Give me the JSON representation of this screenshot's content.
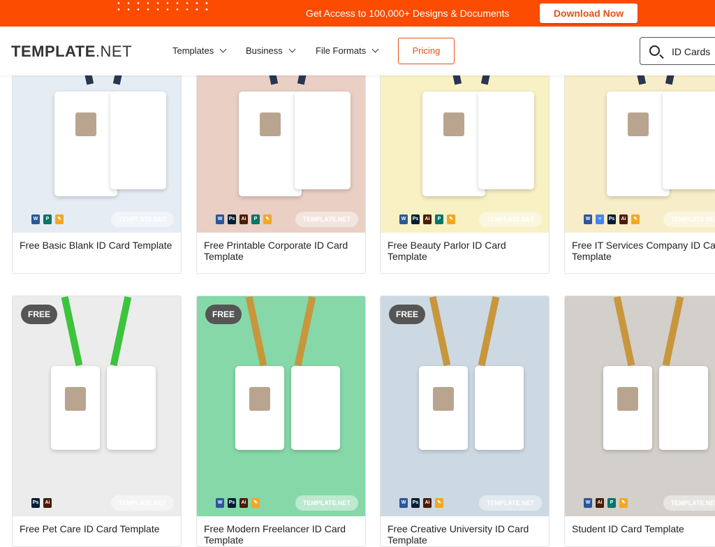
{
  "promo": {
    "text": "Get Access to 100,000+ Designs & Documents",
    "button": "Download Now",
    "color": "#fc4c02"
  },
  "header": {
    "logo_bold": "TEMPLATE",
    "logo_light": ".NET",
    "nav": [
      "Templates",
      "Business",
      "File Formats"
    ],
    "pricing": "Pricing",
    "search_value": "ID Cards"
  },
  "watermark": "TEMPLATE.NET",
  "badge_free": "FREE",
  "cards": [
    {
      "title": "Free Basic Blank ID Card Template",
      "formats": [
        "word",
        "publisher",
        "pages"
      ],
      "bg": "#e6ecf4",
      "free": false
    },
    {
      "title": "Free Printable Corporate ID Card Template",
      "formats": [
        "word",
        "photoshop",
        "illustrator",
        "publisher",
        "pages"
      ],
      "bg": "#e9cfc4",
      "free": false
    },
    {
      "title": "Free Beauty Parlor ID Card Template",
      "formats": [
        "word",
        "photoshop",
        "illustrator",
        "publisher",
        "pages"
      ],
      "bg": "#f8f1c4",
      "free": false
    },
    {
      "title": "Free IT Services Company ID Card Template",
      "formats": [
        "word",
        "google-docs",
        "photoshop",
        "illustrator",
        "pages"
      ],
      "bg": "#f7edc8",
      "free": false
    },
    {
      "title": "Free Pet Care ID Card Template",
      "formats": [
        "photoshop",
        "illustrator"
      ],
      "bg": "#ececec",
      "free": true
    },
    {
      "title": "Free Modern Freelancer ID Card Template",
      "formats": [
        "word",
        "photoshop",
        "illustrator",
        "pages"
      ],
      "bg": "#86d8a8",
      "free": true
    },
    {
      "title": "Free Creative University ID Card Template",
      "formats": [
        "word",
        "photoshop",
        "illustrator",
        "pages"
      ],
      "bg": "#cdd9e2",
      "free": true
    },
    {
      "title": "Student ID Card Template",
      "formats": [
        "word",
        "illustrator",
        "publisher",
        "pages"
      ],
      "bg": "#d3cfca",
      "free": false
    }
  ]
}
